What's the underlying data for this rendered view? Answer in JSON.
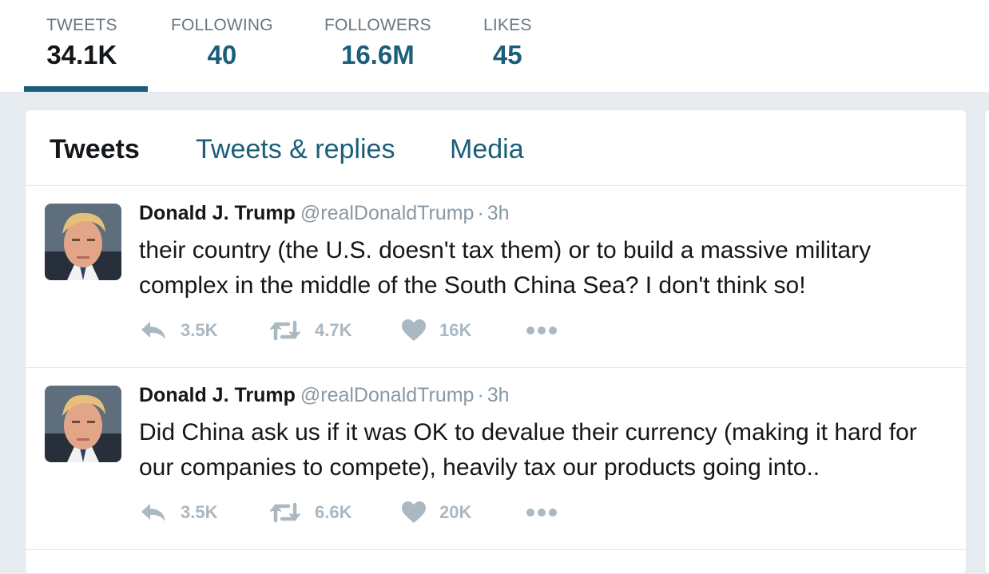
{
  "profile_nav": {
    "stats": [
      {
        "label": "TWEETS",
        "value": "34.1K"
      },
      {
        "label": "FOLLOWING",
        "value": "40"
      },
      {
        "label": "FOLLOWERS",
        "value": "16.6M"
      },
      {
        "label": "LIKES",
        "value": "45"
      }
    ]
  },
  "timeline": {
    "tabs": [
      {
        "label": "Tweets"
      },
      {
        "label": "Tweets & replies"
      },
      {
        "label": "Media"
      }
    ],
    "tweets": [
      {
        "name": "Donald J. Trump",
        "handle": "@realDonaldTrump",
        "separator": "·",
        "time": "3h",
        "text": "their country (the U.S. doesn't tax them) or to build a massive military complex in the middle of the South China Sea?  I don't think so!",
        "replies": "3.5K",
        "retweets": "4.7K",
        "likes": "16K"
      },
      {
        "name": "Donald J. Trump",
        "handle": "@realDonaldTrump",
        "separator": "·",
        "time": "3h",
        "text": "Did China ask us if it was OK to devalue their currency (making it hard for our companies to compete), heavily tax our products going into..",
        "replies": "3.5K",
        "retweets": "6.6K",
        "likes": "20K"
      }
    ]
  },
  "colors": {
    "accent": "#1b5e7a",
    "text": "#14171a",
    "muted": "#8899a6",
    "icon": "#aab8c2",
    "background": "#e6ecf0"
  },
  "icons": [
    "reply-icon",
    "retweet-icon",
    "like-icon",
    "more-icon"
  ]
}
